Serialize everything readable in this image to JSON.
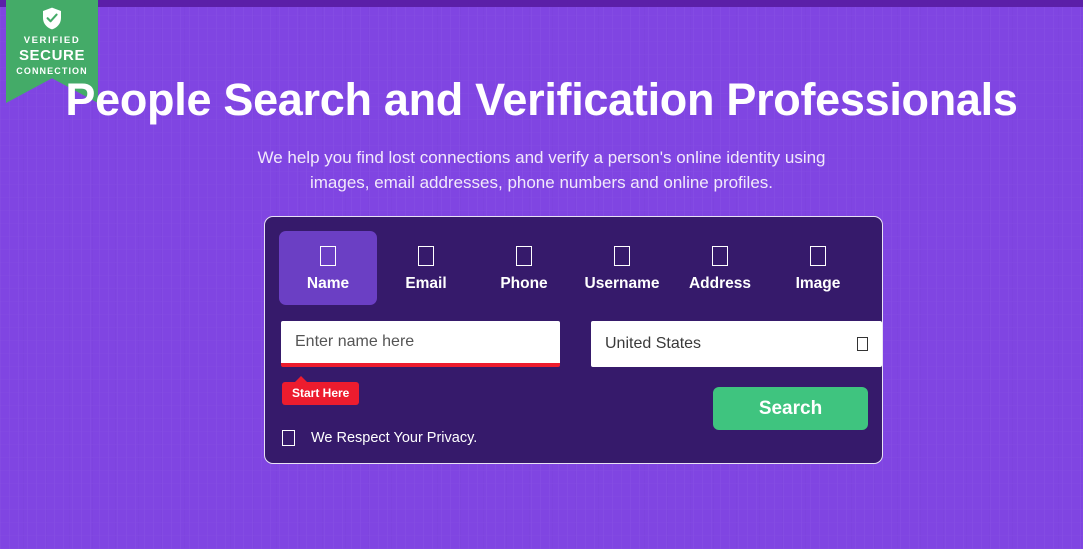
{
  "badge": {
    "icon": "shield-check-icon",
    "line1": "VERIFIED",
    "line2": "SECURE",
    "line3": "CONNECTION",
    "color": "#44ab68"
  },
  "hero": {
    "title": "People Search and Verification Professionals",
    "subtitle": "We help you find lost connections and verify a person's online identity using images, email addresses, phone numbers and online profiles."
  },
  "search_panel": {
    "tabs": [
      {
        "label": "Name",
        "icon": "user-icon",
        "active": true
      },
      {
        "label": "Email",
        "icon": "envelope-icon",
        "active": false
      },
      {
        "label": "Phone",
        "icon": "phone-icon",
        "active": false
      },
      {
        "label": "Username",
        "icon": "at-icon",
        "active": false
      },
      {
        "label": "Address",
        "icon": "map-marker-icon",
        "active": false
      },
      {
        "label": "Image",
        "icon": "image-icon",
        "active": false
      }
    ],
    "name_input": {
      "placeholder": "Enter name here",
      "value": "",
      "underline_color": "#ed1c2e"
    },
    "country_select": {
      "value": "United States",
      "caret_icon": "chevron-down-icon"
    },
    "tooltip": {
      "text": "Start Here",
      "color": "#ed1c2e"
    },
    "search_button": {
      "label": "Search",
      "color": "#3fc47f"
    },
    "privacy": {
      "icon": "lock-icon",
      "text": "We Respect Your Privacy."
    },
    "background": "#361a6b",
    "active_tab_color": "#6b3fc4"
  },
  "theme": {
    "page_background": "#8045e2",
    "top_strip": "#5b1fa8"
  }
}
